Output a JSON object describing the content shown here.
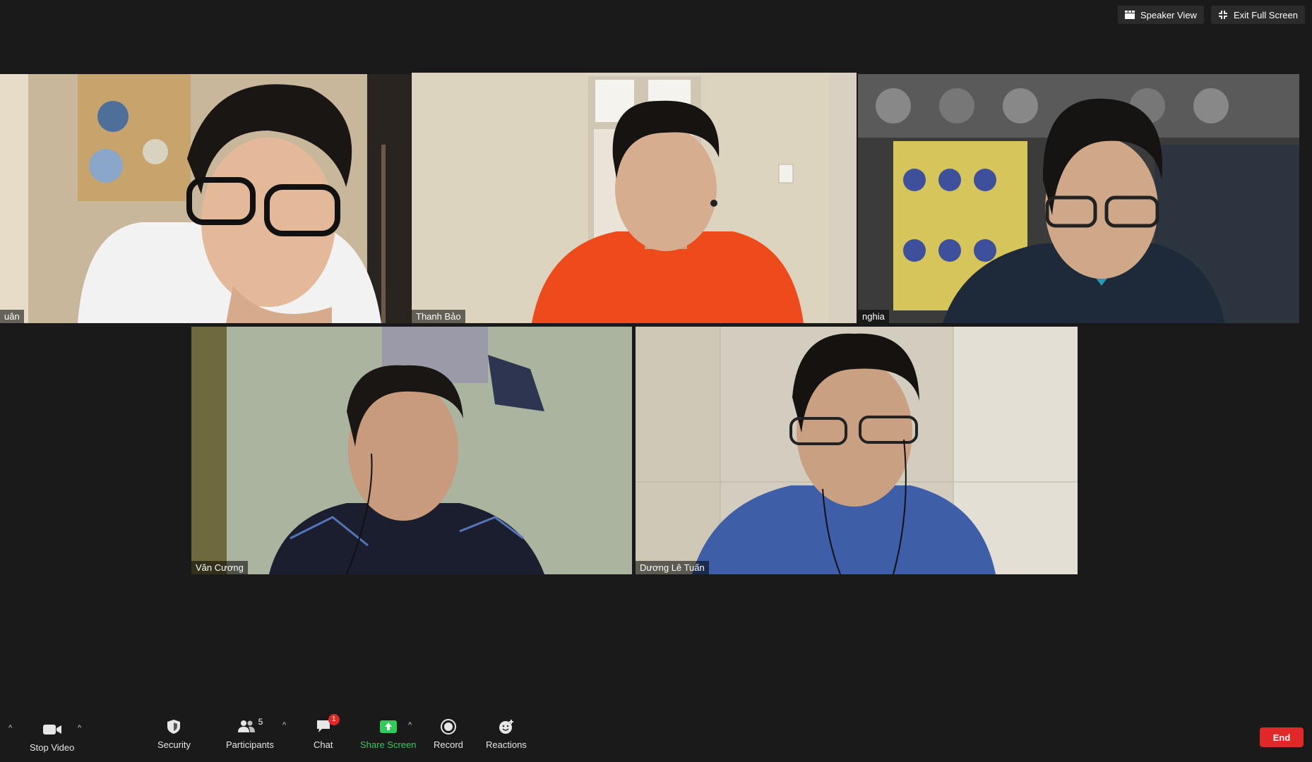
{
  "window": {
    "speaker_view_label": "Speaker View",
    "exit_fullscreen_label": "Exit Full Screen"
  },
  "participants_tiles": [
    {
      "name": "uân",
      "active": false,
      "background": "#c7b59a",
      "shirt": "#f2f2f2"
    },
    {
      "name": "Thanh Bảo",
      "active": true,
      "background": "#ddd6c4",
      "shirt": "#ee4b1c"
    },
    {
      "name": "nghia",
      "active": false,
      "background": "#4a4a4a",
      "shirt": "#1e2a3a"
    },
    {
      "name": "Văn Cương",
      "active": false,
      "background": "#a9b39c",
      "shirt": "#1b1e2e"
    },
    {
      "name": "Dương Lê Tuấn",
      "active": false,
      "background": "#cfcabb",
      "shirt": "#3f5ea8"
    }
  ],
  "toolbar": {
    "stop_video_label": "Stop Video",
    "security_label": "Security",
    "participants_label": "Participants",
    "participants_count": "5",
    "chat_label": "Chat",
    "chat_badge": "1",
    "share_screen_label": "Share Screen",
    "record_label": "Record",
    "reactions_label": "Reactions",
    "end_label": "End"
  },
  "colors": {
    "active_border": "#d8e860",
    "share_green": "#2ecc5b",
    "end_red": "#e02828",
    "background": "#1a1a1a"
  }
}
